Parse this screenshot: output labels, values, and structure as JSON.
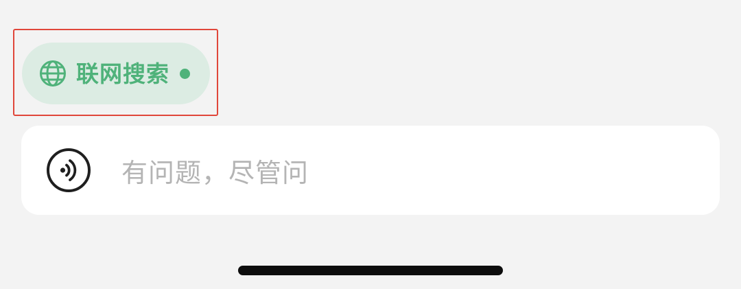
{
  "web_search": {
    "label": "联网搜索",
    "icon": "globe-icon",
    "active": true,
    "accent_color": "#4fb27a",
    "background_color": "#dcece3"
  },
  "composer": {
    "placeholder": "有问题，尽管问",
    "voice_icon": "voice-input-icon"
  },
  "highlight": {
    "color": "#e0463a"
  }
}
